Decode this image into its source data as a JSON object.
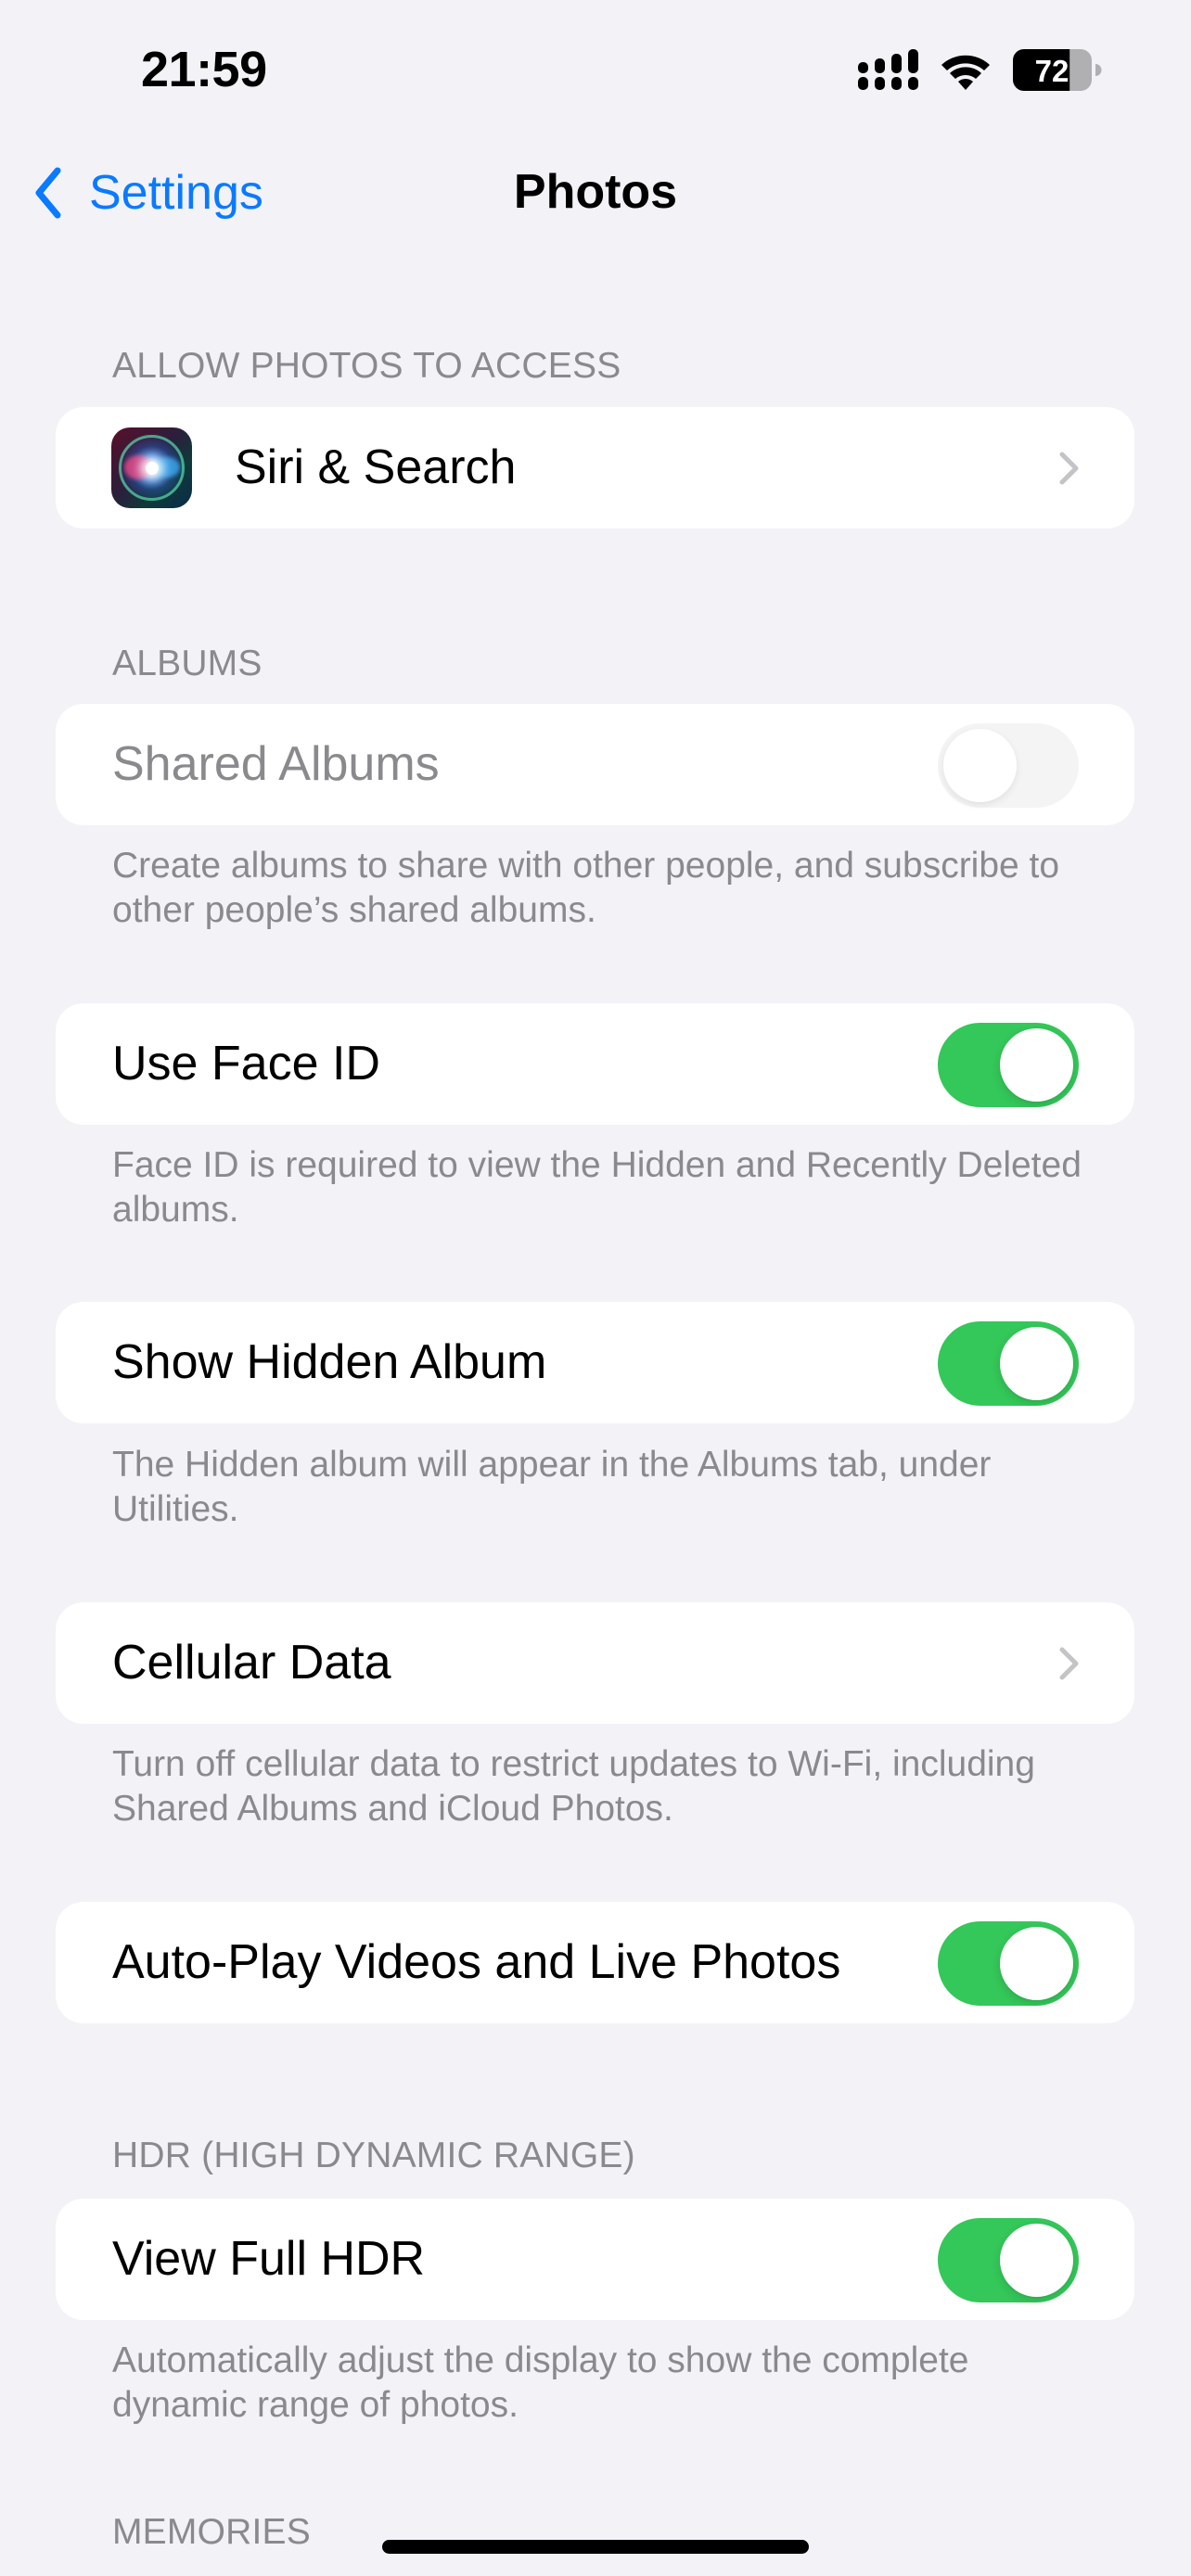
{
  "status_bar": {
    "time": "21:59",
    "signal_icon": "cellular-signal-icon",
    "wifi_icon": "wifi-icon",
    "battery_percent": 72,
    "battery_label": "72"
  },
  "nav": {
    "back_label": "Settings",
    "back_icon": "chevron-left-icon",
    "title": "Photos"
  },
  "sections": [
    {
      "header": "ALLOW PHOTOS TO ACCESS",
      "rows": [
        {
          "label": "Siri & Search",
          "icon": "siri-icon",
          "accessory": "chevron"
        }
      ]
    },
    {
      "header": "ALBUMS",
      "rows": [
        {
          "label": "Shared Albums",
          "accessory": "toggle",
          "value": false,
          "enabled": false
        }
      ],
      "footer": "Create albums to share with other people, and subscribe to other people’s shared albums."
    },
    {
      "rows": [
        {
          "label": "Use Face ID",
          "accessory": "toggle",
          "value": true
        }
      ],
      "footer": "Face ID is required to view the Hidden and Recently Deleted albums."
    },
    {
      "rows": [
        {
          "label": "Show Hidden Album",
          "accessory": "toggle",
          "value": true
        }
      ],
      "footer": "The Hidden album will appear in the Albums tab, under Utilities."
    },
    {
      "rows": [
        {
          "label": "Cellular Data",
          "accessory": "chevron"
        }
      ],
      "footer": "Turn off cellular data to restrict updates to Wi-Fi, including Shared Albums and iCloud Photos."
    },
    {
      "rows": [
        {
          "label": "Auto-Play Videos and Live Photos",
          "accessory": "toggle",
          "value": true
        }
      ]
    },
    {
      "header": "HDR (HIGH DYNAMIC RANGE)",
      "rows": [
        {
          "label": "View Full HDR",
          "accessory": "toggle",
          "value": true
        }
      ],
      "footer": "Automatically adjust the display to show the complete dynamic range of photos."
    },
    {
      "header": "MEMORIES"
    }
  ],
  "colors": {
    "accent": "#0A7AFF",
    "toggle_on": "#34C759",
    "background": "#F2F2F7",
    "secondary_text": "#8A8A8E"
  }
}
